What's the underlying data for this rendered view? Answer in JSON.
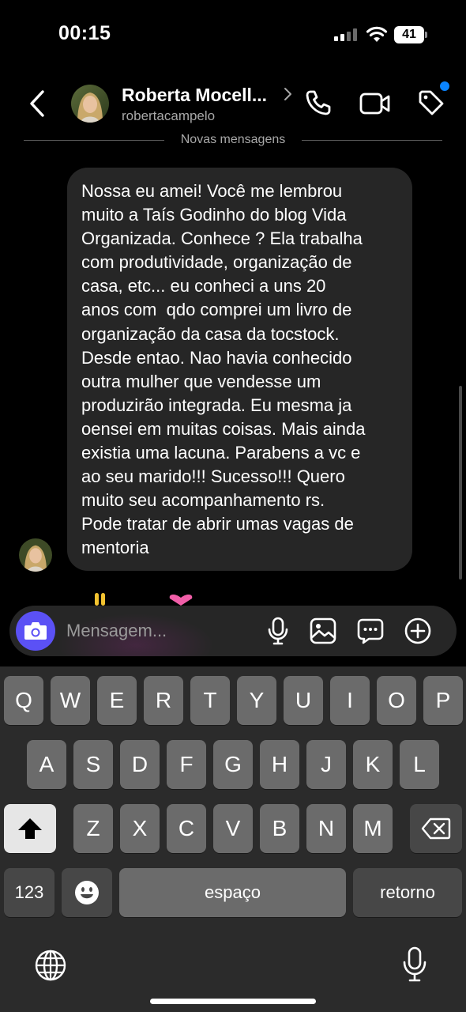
{
  "status_bar": {
    "time": "00:15",
    "battery_level": "41"
  },
  "header": {
    "name": "Roberta Mocell...",
    "username": "robertacampelo"
  },
  "separator": {
    "label": "Novas mensagens"
  },
  "message": {
    "text": "Nossa eu amei! Você me lembrou\nmuito a Taís Godinho do blog Vida\nOrganizada. Conhece ? Ela trabalha\ncom produtividade, organização de\ncasa, etc... eu conheci a uns 20\nanos com  qdo comprei um livro de\norganização da casa da tocstock.\nDesde entao. Nao havia conhecido\noutra mulher que vendesse um\nproduzirão integrada. Eu mesma ja\noensei em muitas coisas. Mais ainda\nexistia uma lacuna. Parabens a vc e\nao seu marido!!! Sucesso!!! Quero\nmuito seu acompanhamento rs.\nPode tratar de abrir umas vagas de\nmentoria"
  },
  "composer": {
    "placeholder": "Mensagem..."
  },
  "keyboard": {
    "row1": [
      "Q",
      "W",
      "E",
      "R",
      "T",
      "Y",
      "U",
      "I",
      "O",
      "P"
    ],
    "row2": [
      "A",
      "S",
      "D",
      "F",
      "G",
      "H",
      "J",
      "K",
      "L"
    ],
    "row3": [
      "Z",
      "X",
      "C",
      "V",
      "B",
      "N",
      "M"
    ],
    "numbers_label": "123",
    "space_label": "espaço",
    "return_label": "retorno"
  },
  "icons": {
    "back": "chevron-left-icon",
    "call": "phone-icon",
    "video": "video-camera-icon",
    "tag": "tag-icon",
    "camera": "camera-icon",
    "mic": "microphone-icon",
    "gallery": "image-icon",
    "sticker": "sticker-icon",
    "plus": "plus-circle-icon",
    "shift": "shift-icon",
    "delete": "delete-icon",
    "emoji": "emoji-icon",
    "globe": "globe-icon",
    "dictation": "microphone-icon"
  },
  "colors": {
    "accent": "#5b51f5",
    "notification_dot": "#0a84ff",
    "bubble": "#262626",
    "keyboard_bg": "#2b2b2b"
  }
}
